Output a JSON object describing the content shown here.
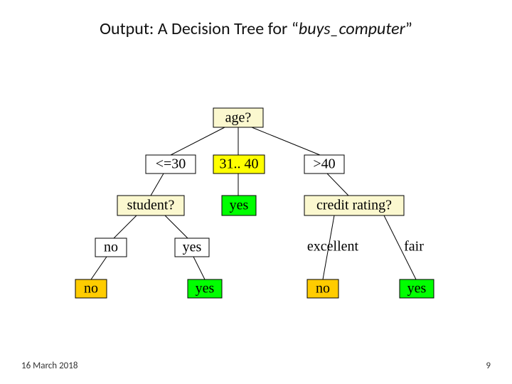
{
  "title_prefix": "Output: A Decision Tree for ",
  "title_quote_open": "“",
  "title_concept": "buys_computer",
  "title_quote_close": "”",
  "footer_date": "16 March 2018",
  "footer_page": "9",
  "root": {
    "label": "age?"
  },
  "root_branches": {
    "left": "<=30",
    "mid": "31.. 40",
    "right": ">40"
  },
  "left_node": {
    "label": "student?"
  },
  "left_branches": {
    "no": "no",
    "yes": "yes"
  },
  "left_leaf_no": "no",
  "left_leaf_yes": "yes",
  "mid_leaf": "yes",
  "right_node": {
    "label": "credit rating?"
  },
  "right_branches": {
    "excellent": "excellent",
    "fair": "fair"
  },
  "right_leaf_excellent": "no",
  "right_leaf_fair": "yes",
  "colors": {
    "pale_yellow": "#fbf8cf",
    "bright_yellow": "#ffff00",
    "white": "#ffffff",
    "green": "#00ff00",
    "orange": "#ffcc00"
  }
}
